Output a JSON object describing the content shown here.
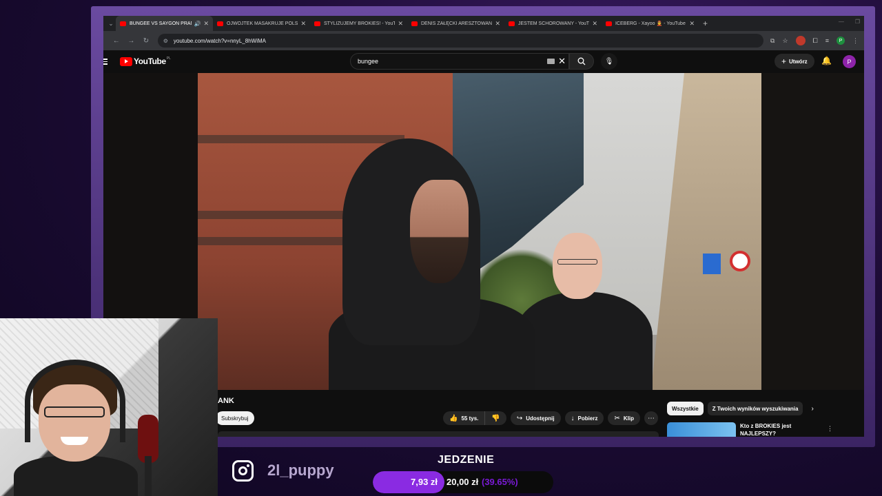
{
  "browser": {
    "tabs": [
      {
        "label": "BUNGEE VS SAYGON PRAN",
        "active": true,
        "audio": true
      },
      {
        "label": "OJWOJTEK MASAKRUJE POLSK"
      },
      {
        "label": "STYLIZUJEMY BROKIES! - YouTu"
      },
      {
        "label": "DENIS ZAŁĘCKI ARESZTOWANY"
      },
      {
        "label": "JESTEM SCHOROWANY - YouTu"
      },
      {
        "label": "ICEBERG - Xayoo 👲 - YouTube"
      }
    ],
    "new_tab": "+",
    "url": "youtube.com/watch?v=nnyL_8hWiMA"
  },
  "youtube": {
    "logo_text": "YouTube",
    "region": "PL",
    "search_value": "bungee",
    "create_label": "Utwórz",
    "avatar_letter": "P",
    "video_title_fragment": "ANK",
    "subscribe_label": "Subskrybuj",
    "like_count": "55 tys.",
    "share_label": "Udostępnij",
    "download_label": "Pobierz",
    "clip_label": "Klip",
    "chips": [
      "Wszystkie",
      "Z Twoich wyników wyszukiwania"
    ],
    "recommendation_title": "Kto z BROKIES jest NAJLEPSZY?"
  },
  "overlay": {
    "instagram_handle": "2l_puppy",
    "goal_title": "JEDZENIE",
    "goal_current": "7,93 zł",
    "goal_target": "20,00 zł",
    "goal_percent": "(39.65%)",
    "goal_fraction": 0.3965
  },
  "colors": {
    "accent": "#8a2be2",
    "yt_red": "#ff0000"
  }
}
